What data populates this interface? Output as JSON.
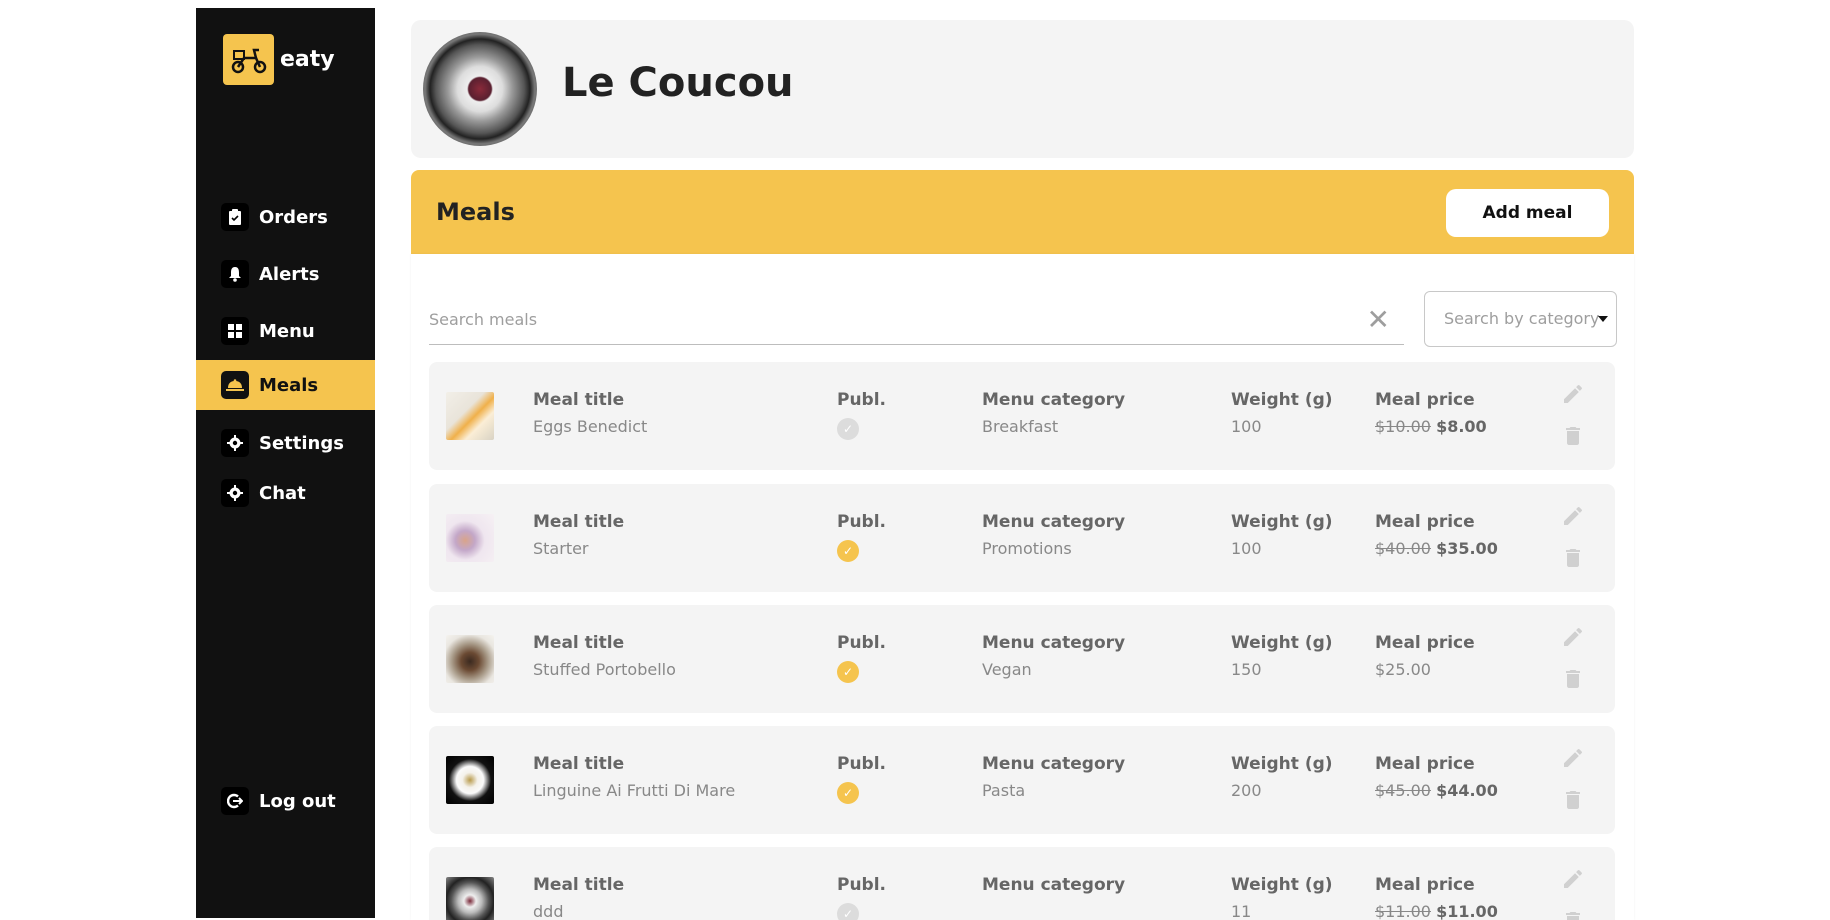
{
  "sidebar": {
    "logo_text": "eaty",
    "items": [
      {
        "label": "Orders",
        "icon": "clipboard-icon"
      },
      {
        "label": "Alerts",
        "icon": "bell-icon"
      },
      {
        "label": "Menu",
        "icon": "grid-icon"
      },
      {
        "label": "Meals",
        "icon": "cloche-icon",
        "active": true
      },
      {
        "label": "Settings",
        "icon": "gear-icon"
      },
      {
        "label": "Chat",
        "icon": "gear-icon"
      }
    ],
    "logout_label": "Log out"
  },
  "header": {
    "restaurant_name": "Le Coucou"
  },
  "meals": {
    "title": "Meals",
    "add_label": "Add meal",
    "search_placeholder": "Search meals",
    "category_placeholder": "Search by category"
  },
  "columns": {
    "title": "Meal title",
    "published": "Publ.",
    "category": "Menu category",
    "weight": "Weight (g)",
    "price": "Meal price"
  },
  "rows": [
    {
      "title": "Eggs Benedict",
      "published": false,
      "category": "Breakfast",
      "weight": "100",
      "old_price": "$10.00",
      "price": "$8.00"
    },
    {
      "title": "Starter",
      "published": true,
      "category": "Promotions",
      "weight": "100",
      "old_price": "$40.00",
      "price": "$35.00"
    },
    {
      "title": "Stuffed Portobello",
      "published": true,
      "category": "Vegan",
      "weight": "150",
      "old_price": "",
      "price": "$25.00"
    },
    {
      "title": "Linguine Ai Frutti Di Mare",
      "published": true,
      "category": "Pasta",
      "weight": "200",
      "old_price": "$45.00",
      "price": "$44.00"
    },
    {
      "title": "ddd",
      "published": false,
      "category": "",
      "weight": "11",
      "old_price": "$11.00",
      "price": "$11.00"
    }
  ],
  "colors": {
    "accent": "#F5C44E",
    "sidebar_bg": "#111111",
    "row_bg": "#F4F4F4"
  }
}
